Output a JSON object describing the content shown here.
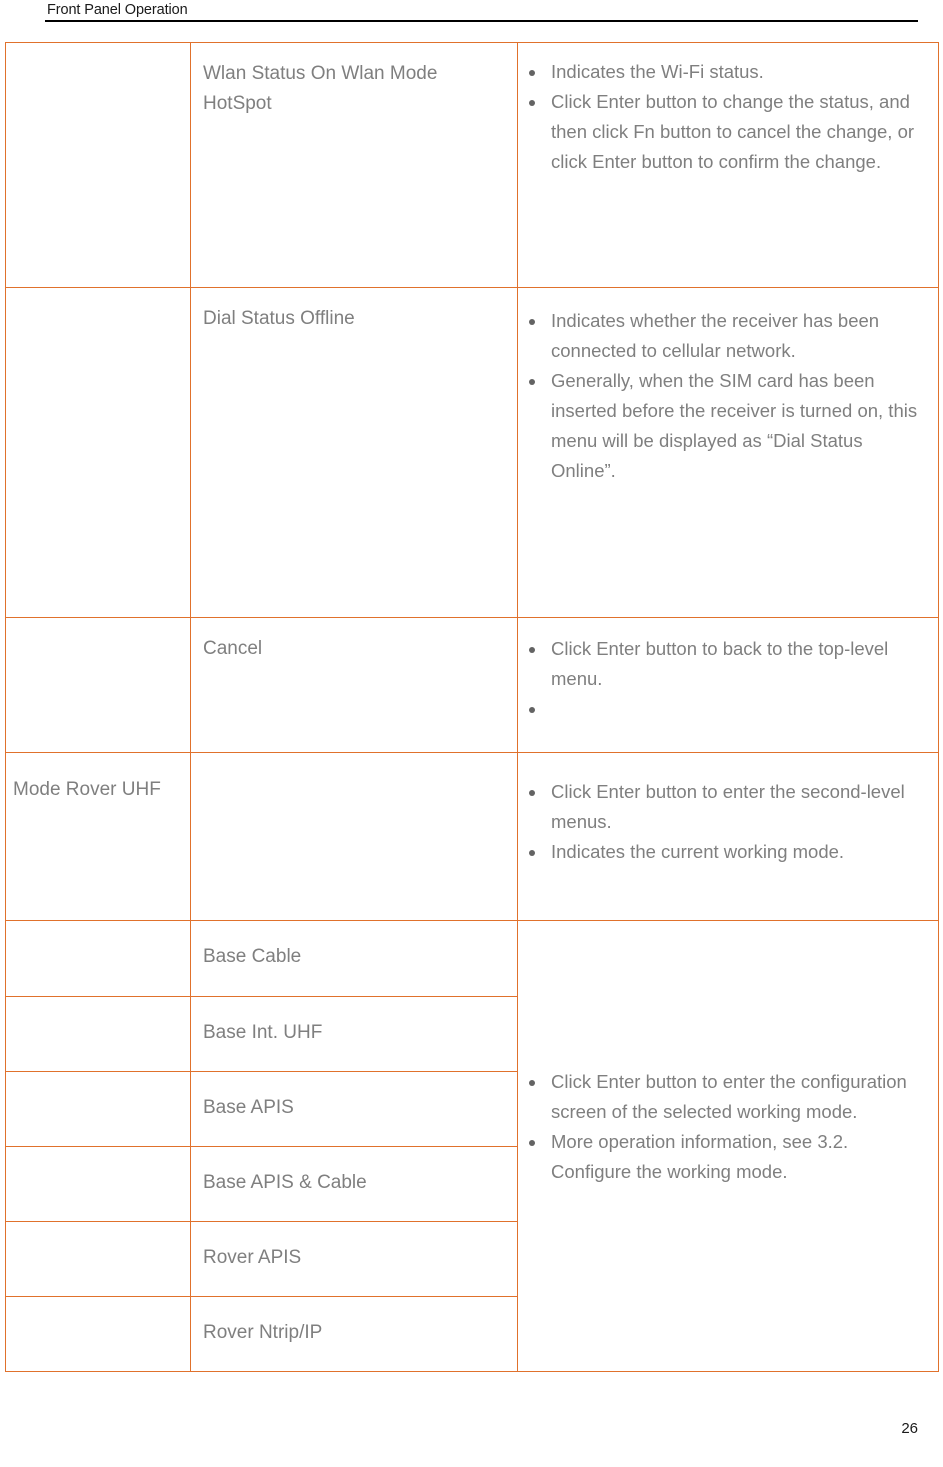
{
  "header": {
    "running_title": "Front Panel Operation"
  },
  "footer": {
    "page_number": "26"
  },
  "table": {
    "rows": [
      {
        "id": "wlan-status",
        "col1": "",
        "col2": "Wlan Status On Wlan Mode HotSpot",
        "notes": [
          "Indicates the Wi-Fi status.",
          "Click Enter button to change the status, and then click Fn button to cancel the change, or click Enter button to confirm the change."
        ]
      },
      {
        "id": "dial-status",
        "col1": "",
        "col2": "Dial Status Offline",
        "notes": [
          "Indicates whether the receiver has been connected to cellular network.",
          "Generally, when the SIM card has been inserted before the receiver is turned on, this menu will be displayed as “Dial Status Online”."
        ]
      },
      {
        "id": "cancel",
        "col1": "",
        "col2": "Cancel",
        "notes": [
          "Click Enter button to back to the top-level menu.",
          ""
        ]
      },
      {
        "id": "mode-rover-uhf",
        "col1": "Mode Rover UHF",
        "col2": "",
        "notes": [
          "Click Enter button to enter the second-level menus.",
          "Indicates the current working mode."
        ]
      }
    ],
    "mode_group": {
      "items": [
        {
          "id": "base-cable",
          "label": "Base Cable"
        },
        {
          "id": "base-int-uhf",
          "label": "Base Int. UHF"
        },
        {
          "id": "base-apis",
          "label": "Base APIS"
        },
        {
          "id": "base-apis-cable",
          "label": "Base APIS & Cable"
        },
        {
          "id": "rover-apis",
          "label": "Rover APIS"
        },
        {
          "id": "rover-ntrip-ip",
          "label": "Rover Ntrip/IP"
        }
      ],
      "notes": [
        "Click Enter button to enter the configuration screen of the selected working mode.",
        "More operation information, see 3.2. Configure the working mode."
      ]
    }
  },
  "colors": {
    "table_border": "#E0712C",
    "body_text": "#7f7f7f",
    "header_text": "#1a1a1a",
    "bullet": "#636363"
  }
}
